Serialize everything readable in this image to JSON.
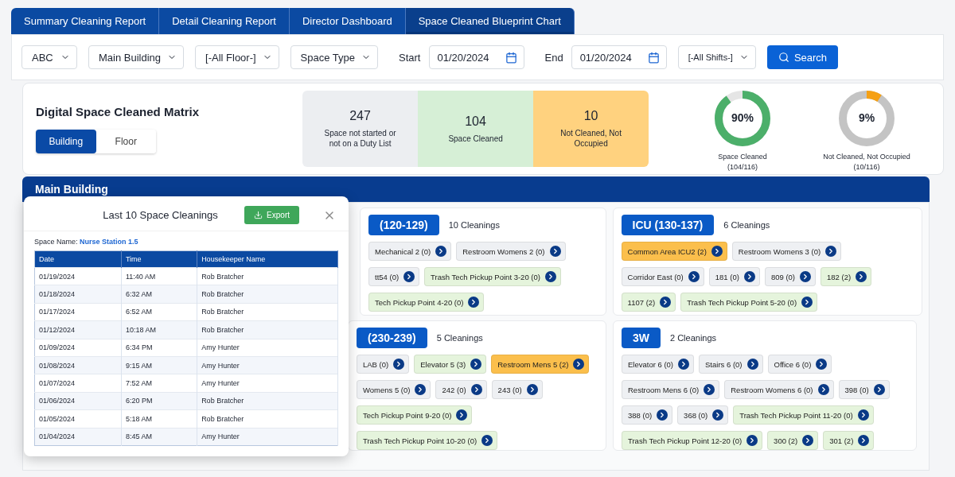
{
  "tabs": [
    {
      "label": "Summary Cleaning Report",
      "selected": false
    },
    {
      "label": "Detail Cleaning Report",
      "selected": false
    },
    {
      "label": "Director Dashboard",
      "selected": false
    },
    {
      "label": "Space Cleaned Blueprint Chart",
      "selected": true
    }
  ],
  "filters": {
    "selects": [
      "ABC",
      "Main Building",
      "[-All Floor-]",
      "Space Type"
    ],
    "start_label": "Start",
    "start_date": "01/20/2024",
    "end_label": "End",
    "end_date": "01/20/2024",
    "shift": "[-All Shifts-]",
    "search_button": "Search"
  },
  "summary": {
    "title": "Digital Space Cleaned Matrix",
    "toggle": [
      {
        "label": "Building",
        "selected": true
      },
      {
        "label": "Floor",
        "selected": false
      }
    ],
    "stats": [
      {
        "value": "247",
        "label": "Space not started or not on a Duty List",
        "color": "#eceef1"
      },
      {
        "value": "104",
        "label": "Space Cleaned",
        "color": "#d6efd6"
      },
      {
        "value": "10",
        "label": "Not Cleaned, Not Occupied",
        "color": "#ffd27f"
      }
    ],
    "donuts": [
      {
        "percent": "90%",
        "level": 0.9,
        "color": "#4caf6a",
        "label": "Space Cleaned",
        "count": "(104/116)"
      },
      {
        "percent": "9%",
        "level": 0.09,
        "color": "#f5a014",
        "label": "Not Cleaned, Not Occupied",
        "count": "(10/116)"
      }
    ]
  },
  "building": {
    "title": "Main Building",
    "rows": [
      [
        {
          "name": "(120-129)",
          "count": "10 Cleanings",
          "spaces": [
            {
              "label": "Mechanical 2 (0)",
              "color": "#eef0f3"
            },
            {
              "label": "Restroom Womens 2 (0)",
              "color": "#eef0f3"
            },
            {
              "label": "tt54 (0)",
              "color": "#eef0f3"
            },
            {
              "label": "Trash Tech Pickup Point 3-20 (0)",
              "color": "#e5f4dc"
            },
            {
              "label": "Tech Pickup Point 4-20 (0)",
              "color": "#e5f4dc"
            }
          ]
        },
        {
          "name": "ICU (130-137)",
          "count": "6 Cleanings",
          "spaces": [
            {
              "label": "Common Area ICU2 (2)",
              "color": "#fbbf4c"
            },
            {
              "label": "Restroom Womens 3 (0)",
              "color": "#eef0f3"
            },
            {
              "label": "Corridor East (0)",
              "color": "#eef0f3"
            },
            {
              "label": "181 (0)",
              "color": "#eef0f3"
            },
            {
              "label": "809 (0)",
              "color": "#eef0f3"
            },
            {
              "label": "182 (2)",
              "color": "#e5f4dc"
            },
            {
              "label": "1107 (2)",
              "color": "#e5f4dc"
            },
            {
              "label": "Trash Tech Pickup Point 5-20 (0)",
              "color": "#e5f4dc"
            }
          ]
        }
      ],
      [
        {
          "name": "(230-239)",
          "count": "5 Cleanings",
          "spaces": [
            {
              "label": "LAB (0)",
              "color": "#eef0f3"
            },
            {
              "label": "Elevator 5 (3)",
              "color": "#e5f4dc"
            },
            {
              "label": "Restroom Mens 5 (2)",
              "color": "#fbbf4c"
            },
            {
              "label": "Womens 5 (0)",
              "color": "#eef0f3"
            },
            {
              "label": "242 (0)",
              "color": "#eef0f3"
            },
            {
              "label": "243 (0)",
              "color": "#eef0f3"
            },
            {
              "label": "Tech Pickup Point 9-20 (0)",
              "color": "#e5f4dc"
            },
            {
              "label": "Trash Tech Pickup Point 10-20 (0)",
              "color": "#e5f4dc"
            }
          ]
        },
        {
          "name": "3W",
          "count": "2 Cleanings",
          "spaces": [
            {
              "label": "Elevator 6 (0)",
              "color": "#eef0f3"
            },
            {
              "label": "Stairs 6 (0)",
              "color": "#eef0f3"
            },
            {
              "label": "Office 6 (0)",
              "color": "#eef0f3"
            },
            {
              "label": "Restroom Mens 6 (0)",
              "color": "#eef0f3"
            },
            {
              "label": "Restroom Womens 6 (0)",
              "color": "#eef0f3"
            },
            {
              "label": "398 (0)",
              "color": "#eef0f3"
            },
            {
              "label": "388 (0)",
              "color": "#eef0f3"
            },
            {
              "label": "368 (0)",
              "color": "#eef0f3"
            },
            {
              "label": "Trash Tech Pickup Point 11-20 (0)",
              "color": "#e5f4dc"
            },
            {
              "label": "Trash Tech Pickup Point 12-20 (0)",
              "color": "#e5f4dc"
            },
            {
              "label": "300 (2)",
              "color": "#e5f4dc"
            },
            {
              "label": "301 (2)",
              "color": "#e5f4dc"
            }
          ]
        }
      ]
    ]
  },
  "popup": {
    "title": "Last 10 Space Cleanings",
    "export_button": "Export",
    "space_label": "Space Name:",
    "space_name": "Nurse Station 1.5",
    "columns": [
      "Date",
      "Time",
      "Housekeeper Name"
    ],
    "rows": [
      [
        "01/19/2024",
        "11:40 AM",
        "Rob Bratcher"
      ],
      [
        "01/18/2024",
        "6:32 AM",
        "Rob Bratcher"
      ],
      [
        "01/17/2024",
        "6:52 AM",
        "Rob Bratcher"
      ],
      [
        "01/12/2024",
        "10:18 AM",
        "Rob Bratcher"
      ],
      [
        "01/09/2024",
        "6:34 PM",
        "Amy Hunter"
      ],
      [
        "01/08/2024",
        "9:15 AM",
        "Amy Hunter"
      ],
      [
        "01/07/2024",
        "7:52 AM",
        "Amy Hunter"
      ],
      [
        "01/06/2024",
        "6:20 PM",
        "Rob Bratcher"
      ],
      [
        "01/05/2024",
        "5:18 AM",
        "Rob Bratcher"
      ],
      [
        "01/04/2024",
        "8:45 AM",
        "Amy Hunter"
      ]
    ]
  }
}
